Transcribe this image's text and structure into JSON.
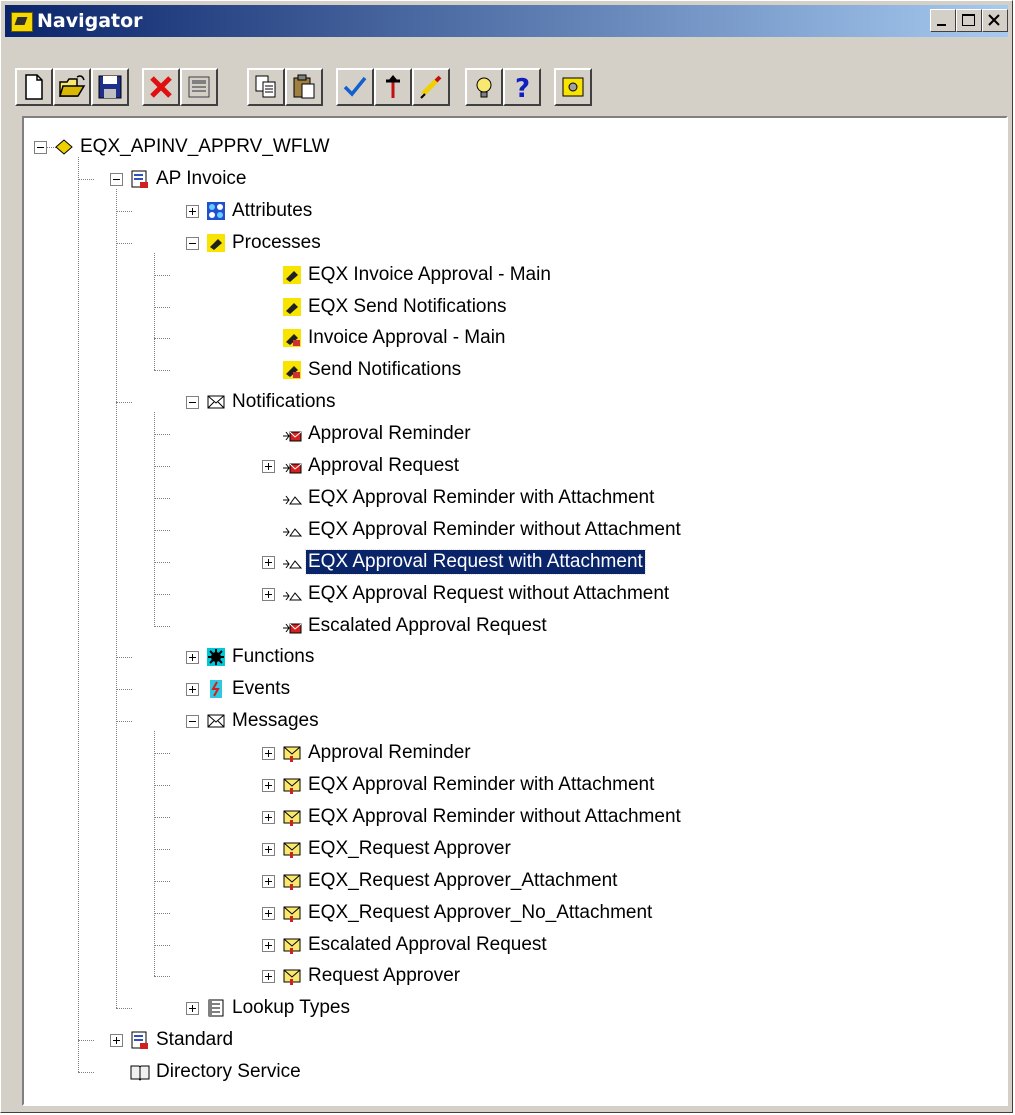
{
  "window": {
    "title": "Navigator"
  },
  "toolbar": {
    "buttons": [
      "new-icon",
      "open-icon",
      "save-icon",
      "delete-icon",
      "properties-icon",
      "copy-icon",
      "paste-icon",
      "verify-icon",
      "push-icon",
      "highlight-icon",
      "tip-icon",
      "help-icon",
      "quick-start-icon"
    ]
  },
  "tree": {
    "root": "EQX_APINV_APPRV_WFLW",
    "ap_invoice": "AP Invoice",
    "attributes": "Attributes",
    "processes": "Processes",
    "process_items": [
      "EQX Invoice Approval - Main",
      "EQX Send Notifications",
      "Invoice Approval - Main",
      "Send Notifications"
    ],
    "notifications": "Notifications",
    "notification_items": [
      "Approval Reminder",
      "Approval Request",
      "EQX Approval Reminder with Attachment",
      "EQX Approval Reminder without Attachment",
      "EQX Approval Request with Attachment",
      "EQX Approval Request without Attachment",
      "Escalated Approval Request"
    ],
    "functions": "Functions",
    "events": "Events",
    "messages": "Messages",
    "message_items": [
      "Approval Reminder",
      "EQX Approval Reminder with Attachment",
      "EQX Approval Reminder without Attachment",
      "EQX_Request Approver",
      "EQX_Request Approver_Attachment",
      "EQX_Request Approver_No_Attachment",
      "Escalated Approval Request",
      "Request Approver"
    ],
    "lookup_types": "Lookup Types",
    "standard": "Standard",
    "directory_service": "Directory Service"
  }
}
